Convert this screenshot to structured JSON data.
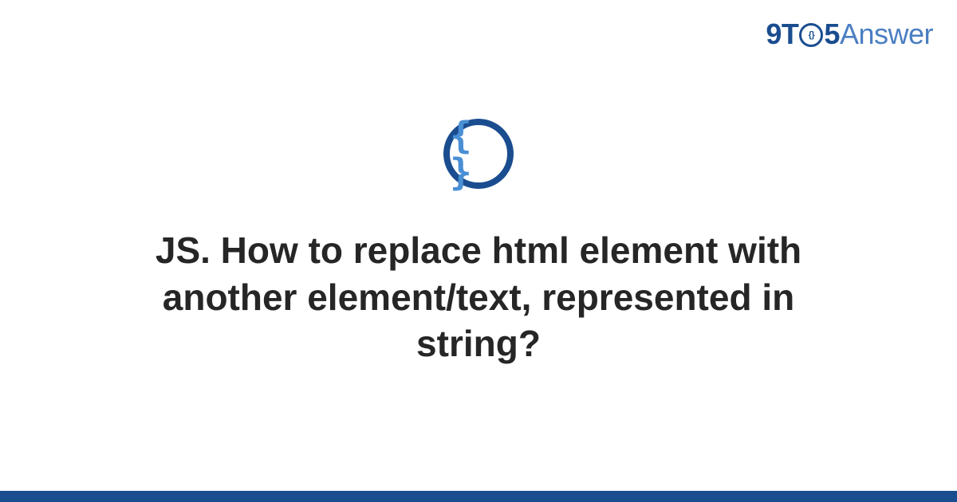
{
  "brand": {
    "part1": "9T",
    "circle_inner": "{}",
    "part2": "5",
    "part3": "Answer"
  },
  "icon": {
    "glyph": "{ }"
  },
  "title": "JS. How to replace html element with another element/text, represented in string?",
  "colors": {
    "brand_dark": "#1a4d8f",
    "brand_light": "#4a7ec2",
    "icon_brace": "#4a8fd4",
    "text": "#262626"
  }
}
